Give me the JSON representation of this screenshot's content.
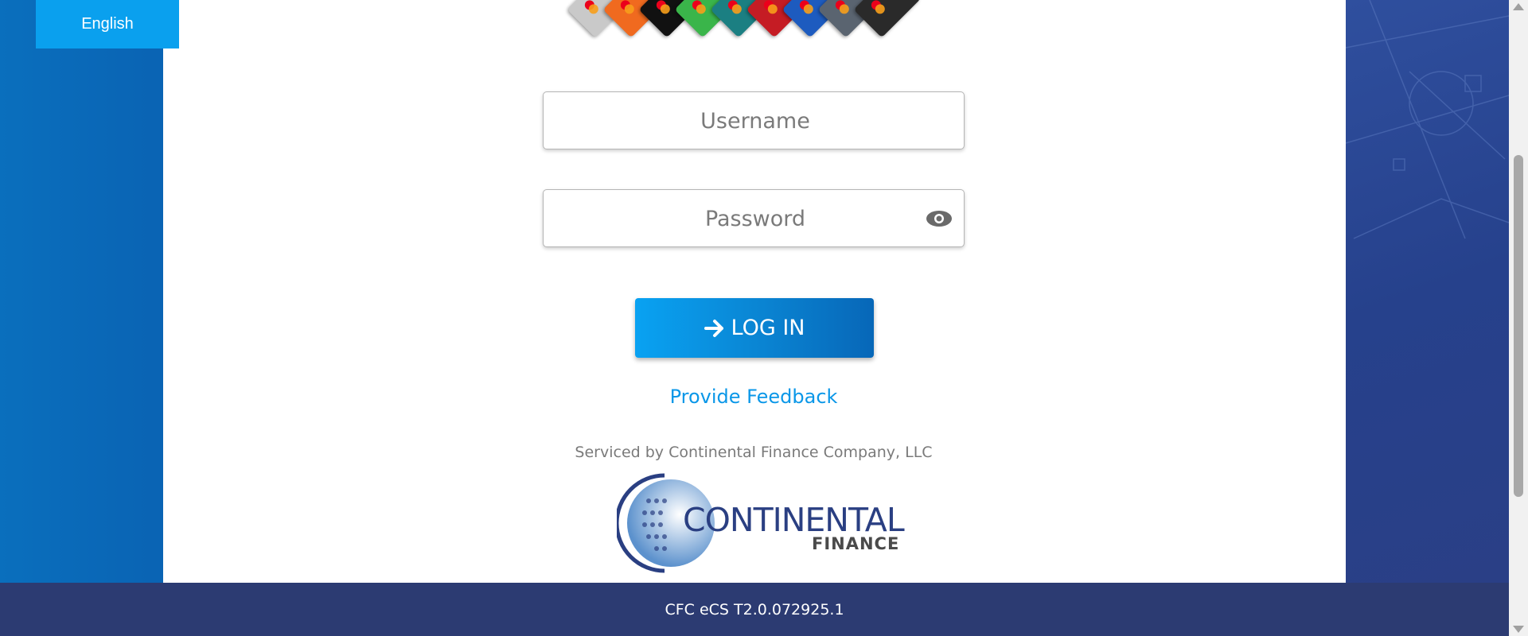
{
  "language_button": {
    "label": "English"
  },
  "login_form": {
    "username_placeholder": "Username",
    "password_placeholder": "Password",
    "login_label": "LOG IN"
  },
  "links": {
    "feedback": "Provide Feedback"
  },
  "servicer": {
    "text": "Serviced by Continental Finance Company, LLC",
    "logo_name": "CONTINENTAL",
    "logo_sub": "FINANCE"
  },
  "footer": {
    "version": "CFC eCS T2.0.072925.1"
  },
  "icons": {
    "password_toggle": "eye-icon",
    "login": "arrow-right-icon"
  },
  "colors": {
    "accent": "#0aa0ee",
    "footer": "#2c3b72",
    "link": "#0a97e8"
  }
}
